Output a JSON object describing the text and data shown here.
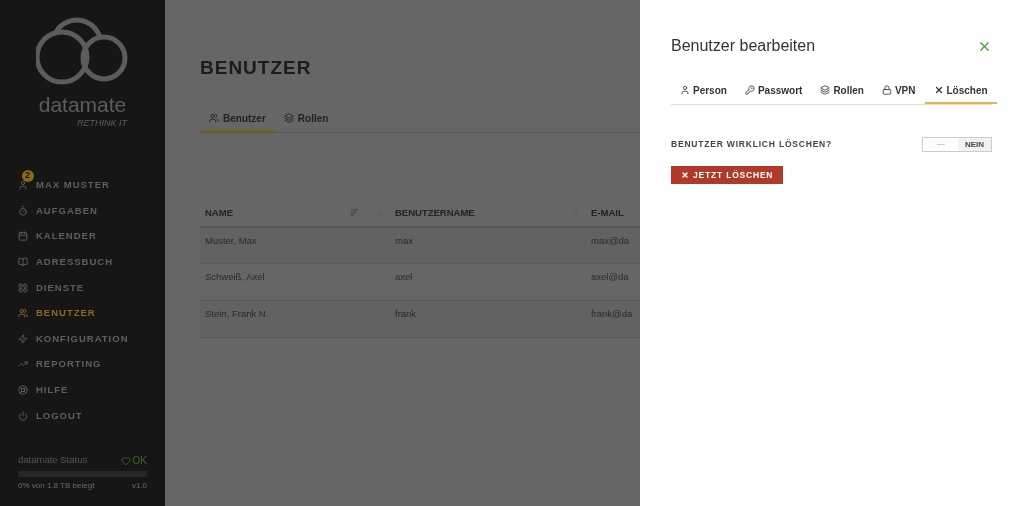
{
  "sidebar": {
    "brand": "datamate",
    "tagline": "RETHINK IT",
    "items": [
      {
        "label": "MAX MUSTER",
        "selected": false,
        "badge": "2"
      },
      {
        "label": "AUFGABEN",
        "selected": false
      },
      {
        "label": "KALENDER",
        "selected": false
      },
      {
        "label": "ADRESSBUCH",
        "selected": false
      },
      {
        "label": "DIENSTE",
        "selected": false
      },
      {
        "label": "BENUTZER",
        "selected": true
      },
      {
        "label": "KONFIGURATION",
        "selected": false
      },
      {
        "label": "REPORTING",
        "selected": false
      },
      {
        "label": "HILFE",
        "selected": false
      },
      {
        "label": "LOGOUT",
        "selected": false
      }
    ],
    "status": {
      "label": "datamate Status",
      "state": "OK",
      "level": 0,
      "usage": "0% von 1.8 TB belegt",
      "version": "v1.0"
    }
  },
  "page": {
    "title": "BENUTZER",
    "tabs": [
      {
        "label": "Benutzer",
        "selected": true
      },
      {
        "label": "Rollen",
        "selected": false
      }
    ],
    "table": {
      "columns": [
        "NAME",
        "BENUTZERNAME",
        "E-MAIL"
      ],
      "rows": [
        [
          "Muster, Max",
          "max",
          "max@da"
        ],
        [
          "Schweiß, Axel",
          "axel",
          "axel@da"
        ],
        [
          "Stein, Frank N.",
          "frank",
          "frank@da"
        ]
      ]
    }
  },
  "drawer": {
    "title": "Benutzer bearbeiten",
    "tabs": [
      {
        "label": "Person",
        "selected": false
      },
      {
        "label": "Passwort",
        "selected": false
      },
      {
        "label": "Rollen",
        "selected": false
      },
      {
        "label": "VPN",
        "selected": false
      },
      {
        "label": "Löschen",
        "selected": true
      }
    ],
    "question": "BENUTZER WIRKLICH LÖSCHEN?",
    "toggle": {
      "on": false,
      "label": "NEIN"
    },
    "delete_button": "JETZT LÖSCHEN"
  }
}
